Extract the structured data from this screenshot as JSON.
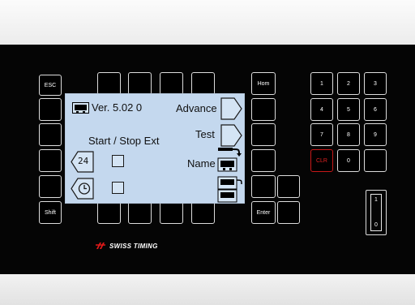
{
  "keys": {
    "esc": "ESC",
    "shift": "Shift",
    "hom": "Hom",
    "enter": "Enter",
    "numpad": [
      "1",
      "2",
      "3",
      "4",
      "5",
      "6",
      "7",
      "8",
      "9"
    ],
    "clr": "CLR",
    "zero": "0"
  },
  "screen": {
    "version": "Ver. 5.02 0",
    "advance": "Advance",
    "test": "Test",
    "start_stop": "Start / Stop Ext",
    "name": "Name",
    "icon_24": "24"
  },
  "switch": {
    "on": "1",
    "off": "0"
  },
  "brand": "SWISS TIMING",
  "colors": {
    "panel": "#050505",
    "screen": "#c4d8ee",
    "clr": "#c81818"
  }
}
